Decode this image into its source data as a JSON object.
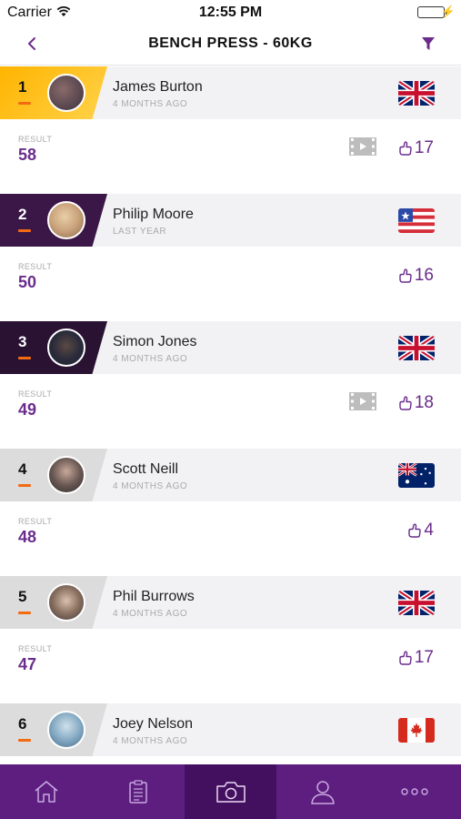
{
  "status_bar": {
    "carrier": "Carrier",
    "time": "12:55 PM"
  },
  "nav": {
    "title": "BENCH PRESS - 60KG"
  },
  "result_label": "RESULT",
  "entries": [
    {
      "rank": "1",
      "name": "James Burton",
      "when": "4 MONTHS AGO",
      "flag": "uk",
      "result": "58",
      "likes": "17",
      "has_video": true,
      "tab_style": "gold"
    },
    {
      "rank": "2",
      "name": "Philip Moore",
      "when": "LAST YEAR",
      "flag": "us",
      "result": "50",
      "likes": "16",
      "has_video": false,
      "tab_style": "purple"
    },
    {
      "rank": "3",
      "name": "Simon Jones",
      "when": "4 MONTHS AGO",
      "flag": "uk",
      "result": "49",
      "likes": "18",
      "has_video": true,
      "tab_style": "dark"
    },
    {
      "rank": "4",
      "name": "Scott Neill",
      "when": "4 MONTHS AGO",
      "flag": "au",
      "result": "48",
      "likes": "4",
      "has_video": false,
      "tab_style": "grey"
    },
    {
      "rank": "5",
      "name": "Phil Burrows",
      "when": "4 MONTHS AGO",
      "flag": "uk",
      "result": "47",
      "likes": "17",
      "has_video": false,
      "tab_style": "grey"
    },
    {
      "rank": "6",
      "name": "Joey Nelson",
      "when": "4 MONTHS AGO",
      "flag": "ca",
      "result": "",
      "likes": "",
      "has_video": false,
      "tab_style": "grey"
    }
  ],
  "tab_bar": [
    {
      "icon": "home-icon",
      "active": false
    },
    {
      "icon": "clipboard-icon",
      "active": false
    },
    {
      "icon": "camera-icon",
      "active": true
    },
    {
      "icon": "profile-icon",
      "active": false
    },
    {
      "icon": "more-icon",
      "active": false
    }
  ],
  "colors": {
    "accent": "#6a2c8c",
    "tabbar": "#5d1e80",
    "rank_dash": "#f26a12",
    "gold": "#ffc21a"
  }
}
